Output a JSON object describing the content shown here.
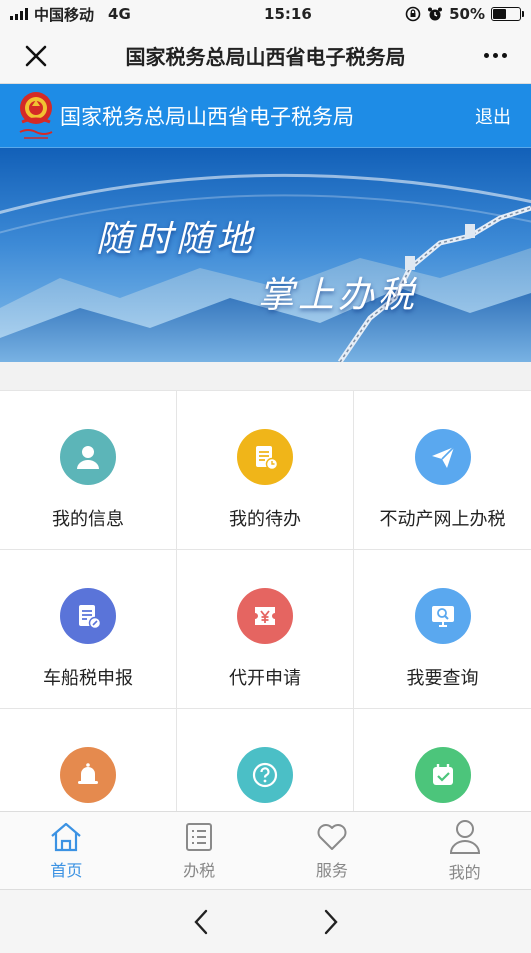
{
  "status_bar": {
    "carrier": "中国移动",
    "network": "4G",
    "time": "15:16",
    "battery": "50%",
    "battery_level": 0.5
  },
  "nav_bar": {
    "title": "国家税务总局山西省电子税务局",
    "close_icon": "close-icon",
    "more_icon": "more-icon"
  },
  "header": {
    "title": "国家税务总局山西省电子税务局",
    "logout_label": "退出",
    "emblem_icon": "tax-emblem-icon"
  },
  "banner": {
    "slogan_line1": "随时随地",
    "slogan_line2": "掌上办税"
  },
  "grid": {
    "items": [
      {
        "label": "我的信息",
        "icon": "user-icon",
        "color": "#5cb5b8"
      },
      {
        "label": "我的待办",
        "icon": "todo-doc-icon",
        "color": "#f0b519"
      },
      {
        "label": "不动产网上办税",
        "icon": "paper-plane-icon",
        "color": "#5aa8ef"
      },
      {
        "label": "车船税申报",
        "icon": "edit-doc-icon",
        "color": "#5a74d9"
      },
      {
        "label": "代开申请",
        "icon": "yuan-ticket-icon",
        "color": "#e56561"
      },
      {
        "label": "我要查询",
        "icon": "search-monitor-icon",
        "color": "#5aa8ef"
      },
      {
        "label": "",
        "icon": "bell-icon",
        "color": "#e58a4e"
      },
      {
        "label": "",
        "icon": "question-icon",
        "color": "#4bbfc6"
      },
      {
        "label": "",
        "icon": "calendar-check-icon",
        "color": "#4cc57b"
      }
    ]
  },
  "tab_bar": {
    "tabs": [
      {
        "label": "首页",
        "icon": "home-icon",
        "active": true
      },
      {
        "label": "办税",
        "icon": "list-icon",
        "active": false
      },
      {
        "label": "服务",
        "icon": "heart-icon",
        "active": false
      },
      {
        "label": "我的",
        "icon": "person-icon",
        "active": false
      }
    ]
  },
  "colors": {
    "accent": "#3b92e3",
    "header_blue": "#1e8ce6"
  }
}
